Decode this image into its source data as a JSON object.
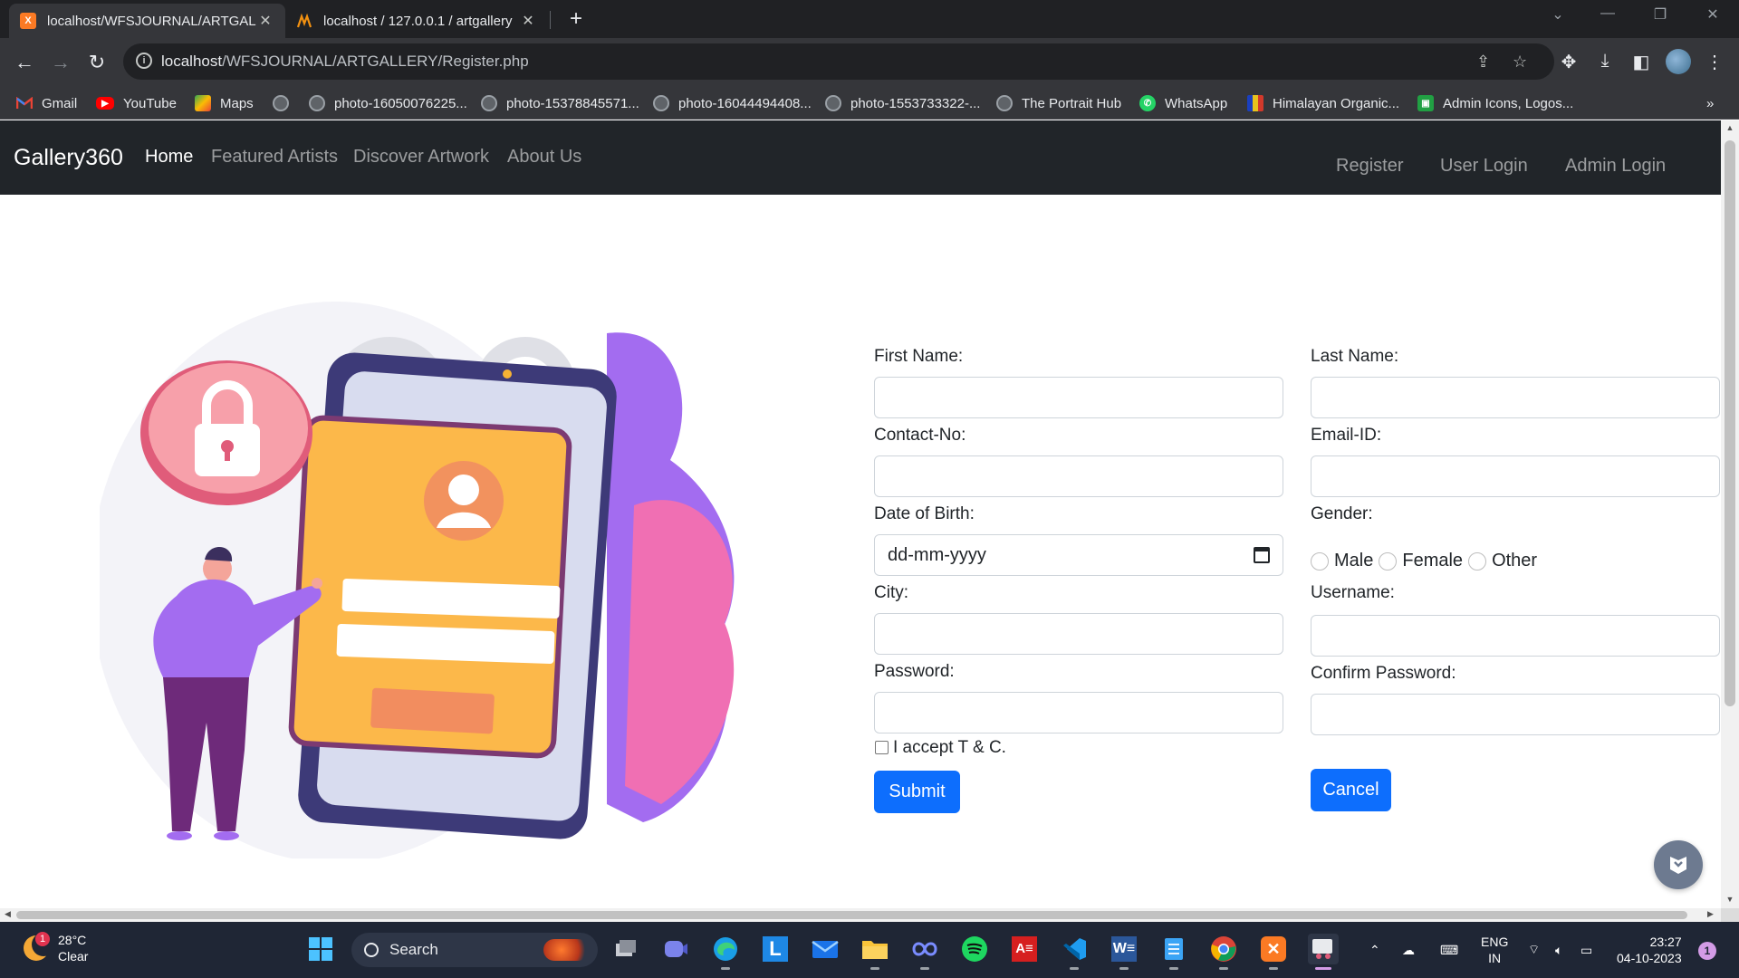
{
  "browser": {
    "tabs": [
      {
        "title": "localhost/WFSJOURNAL/ARTGAL",
        "favicon": "xampp-icon",
        "active": true
      },
      {
        "title": "localhost / 127.0.0.1 / artgallery",
        "favicon": "phpmyadmin-icon",
        "active": false
      }
    ],
    "url_host": "localhost",
    "url_path": "/WFSJOURNAL/ARTGALLERY/Register.php",
    "bookmarks": [
      {
        "label": "Gmail",
        "icon": "gmail-icon"
      },
      {
        "label": "YouTube",
        "icon": "youtube-icon"
      },
      {
        "label": "Maps",
        "icon": "maps-icon"
      },
      {
        "label": "",
        "icon": "globe-icon"
      },
      {
        "label": "photo-16050076225...",
        "icon": "globe-icon"
      },
      {
        "label": "photo-15378845571...",
        "icon": "globe-icon"
      },
      {
        "label": "photo-16044494408...",
        "icon": "globe-icon"
      },
      {
        "label": "photo-1553733322-...",
        "icon": "globe-icon"
      },
      {
        "label": "The Portrait Hub",
        "icon": "globe-icon"
      },
      {
        "label": "WhatsApp",
        "icon": "whatsapp-icon"
      },
      {
        "label": "Himalayan Organic...",
        "icon": "himalayan-icon"
      },
      {
        "label": "Admin Icons, Logos...",
        "icon": "admin-icons-icon"
      }
    ],
    "more_bookmarks": "»"
  },
  "site": {
    "brand": "Gallery360",
    "nav": [
      "Home",
      "Featured Artists",
      "Discover Artwork",
      "About Us"
    ],
    "nav_right": [
      "Register",
      "User Login",
      "Admin Login"
    ]
  },
  "form": {
    "first_name_label": "First Name:",
    "last_name_label": "Last Name:",
    "contact_label": "Contact-No:",
    "email_label": "Email-ID:",
    "dob_label": "Date of Birth:",
    "dob_placeholder": "dd-mm-yyyy",
    "gender_label": "Gender:",
    "gender_options": [
      "Male",
      "Female",
      "Other"
    ],
    "city_label": "City:",
    "username_label": "Username:",
    "password_label": "Password:",
    "confirm_password_label": "Confirm Password:",
    "terms_label": "I accept T & C.",
    "submit_label": "Submit",
    "cancel_label": "Cancel"
  },
  "taskbar": {
    "weather_temp": "28°C",
    "weather_desc": "Clear",
    "weather_badge": "1",
    "search_label": "Search",
    "lang_top": "ENG",
    "lang_bottom": "IN",
    "time": "23:27",
    "date": "04-10-2023",
    "notif_count": "1",
    "pinned": [
      "start-icon",
      "task-view-icon",
      "teams-icon",
      "edge-icon",
      "launcher-icon",
      "mail-icon",
      "file-explorer-icon",
      "infinity-app-icon",
      "spotify-icon",
      "acrobat-icon",
      "vscode-icon",
      "word-icon",
      "notepad-icon",
      "chrome-icon",
      "xampp-icon",
      "snipping-tool-icon"
    ]
  },
  "colors": {
    "navbar_bg": "#212529",
    "primary_button": "#0d6efd",
    "chrome_dark": "#202124",
    "taskbar_bg": "#1f2635"
  }
}
